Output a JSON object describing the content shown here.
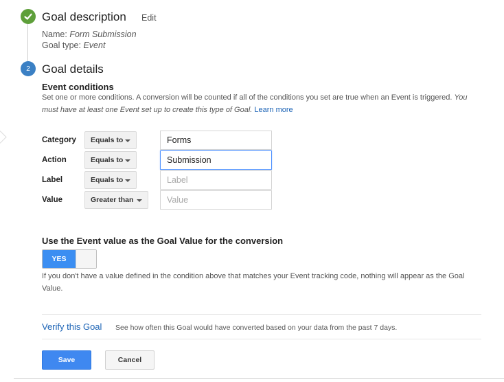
{
  "goal_description": {
    "title": "Goal description",
    "edit_label": "Edit",
    "name_label": "Name:",
    "name_value": "Form Submission",
    "type_label": "Goal type:",
    "type_value": "Event"
  },
  "goal_details": {
    "step_number": "2",
    "title": "Goal details",
    "event_conditions_title": "Event conditions",
    "description_plain": "Set one or more conditions. A conversion will be counted if all of the conditions you set are true when an Event is triggered.",
    "description_italic": "You must have at least one Event set up to create this type of Goal.",
    "learn_more": "Learn more"
  },
  "conditions": [
    {
      "label": "Category",
      "operator": "Equals to",
      "value": "Forms",
      "placeholder": ""
    },
    {
      "label": "Action",
      "operator": "Equals to",
      "value": "Submission",
      "placeholder": ""
    },
    {
      "label": "Label",
      "operator": "Equals to",
      "value": "",
      "placeholder": "Label"
    },
    {
      "label": "Value",
      "operator": "Greater than",
      "value": "",
      "placeholder": "Value"
    }
  ],
  "goal_value": {
    "title": "Use the Event value as the Goal Value for the conversion",
    "toggle_label": "YES",
    "toggle_state": "on",
    "note": "If you don't have a value defined in the condition above that matches your Event tracking code, nothing will appear as the Goal Value."
  },
  "verify": {
    "link_label": "Verify this Goal",
    "description": "See how often this Goal would have converted based on your data from the past 7 days."
  },
  "actions": {
    "save_label": "Save",
    "cancel_label": "Cancel"
  },
  "icons": {
    "step1": "checkmark-icon",
    "dropdown": "caret-down-icon"
  },
  "colors": {
    "step_complete": "#5e9f3a",
    "step_active": "#3b80c4",
    "primary_button": "#3f88f0",
    "link": "#1a62b5"
  }
}
